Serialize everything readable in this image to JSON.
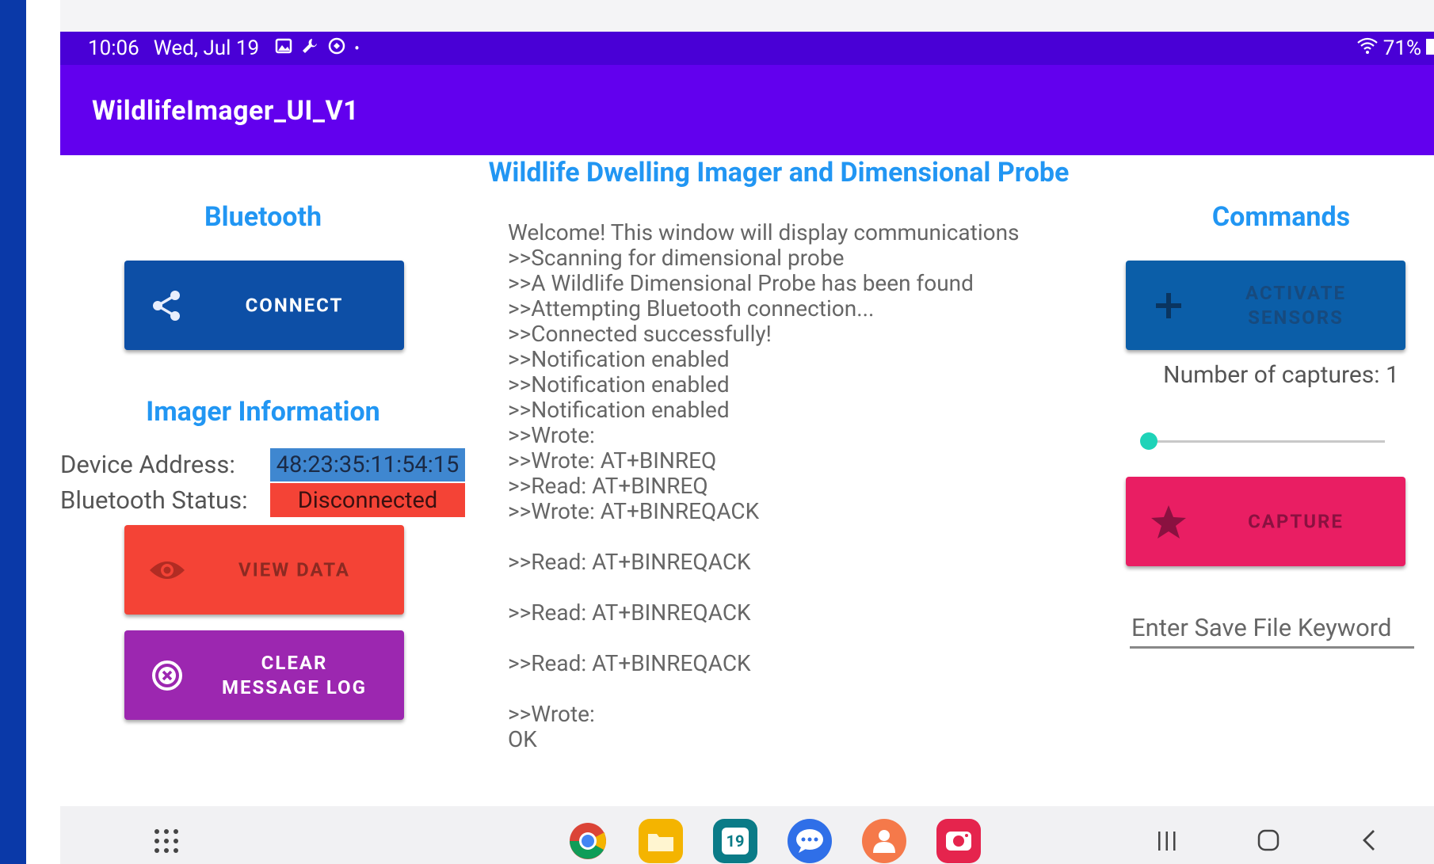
{
  "status": {
    "time": "10:06",
    "date": "Wed, Jul 19",
    "battery": "71%"
  },
  "app": {
    "title": "WildlifeImager_UI_V1",
    "main_title": "Wildlife Dwelling Imager and Dimensional Probe"
  },
  "bluetooth": {
    "heading": "Bluetooth",
    "connect_label": "CONNECT"
  },
  "imager": {
    "heading": "Imager Information",
    "device_address_label": "Device Address:",
    "device_address_value": "48:23:35:11:54:15",
    "bt_status_label": "Bluetooth Status:",
    "bt_status_value": "Disconnected",
    "view_data_label": "VIEW DATA",
    "clear_log_label": "CLEAR\nMESSAGE LOG"
  },
  "log": {
    "text": "Welcome! This window will display communications\n>>Scanning for dimensional probe\n>>A Wildlife Dimensional Probe has been found\n>>Attempting Bluetooth connection...\n>>Connected successfully!\n>>Notification enabled\n>>Notification enabled\n>>Notification enabled\n>>Wrote: \n>>Wrote: AT+BINREQ\n>>Read: AT+BINREQ\n>>Wrote: AT+BINREQACK\n\n>>Read: AT+BINREQACK\n\n>>Read: AT+BINREQACK\n\n>>Read: AT+BINREQACK\n\n>>Wrote: \nOK"
  },
  "commands": {
    "heading": "Commands",
    "activate_label": "ACTIVATE\nSENSORS",
    "captures_text": "Number of captures: 1",
    "captures_value": 1,
    "capture_label": "CAPTURE",
    "keyword_placeholder": "Enter Save File Keyword"
  },
  "colors": {
    "status_bar": "#4900d6",
    "app_bar": "#6200ee",
    "accent_blue": "#2196f3",
    "connect_button": "#0d4fa6",
    "activate_button": "#0b5ea8",
    "view_data_button": "#f44336",
    "clear_log_button": "#9c27b0",
    "capture_button": "#e91e63",
    "address_bg": "#3f87d0",
    "status_bg": "#f44336",
    "slider_thumb": "#1ed3b8"
  },
  "nav": {
    "apps": [
      {
        "name": "chrome-icon",
        "label": "Chrome"
      },
      {
        "name": "folder-icon",
        "label": "My Files"
      },
      {
        "name": "calendar-icon",
        "label": "19"
      },
      {
        "name": "messages-icon",
        "label": "Messages"
      },
      {
        "name": "contacts-icon",
        "label": "Contacts"
      },
      {
        "name": "screen-recorder-icon",
        "label": "Recorder"
      }
    ]
  }
}
